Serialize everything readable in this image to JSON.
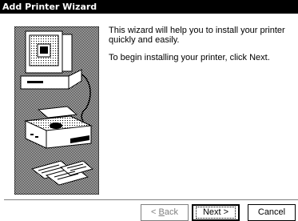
{
  "window": {
    "title": "Add Printer Wizard"
  },
  "content": {
    "paragraph1": "This wizard will help you to install your printer quickly and easily.",
    "paragraph2": "To begin installing your printer, click Next."
  },
  "buttons": {
    "back_prefix": "< ",
    "back_underlined": "B",
    "back_rest": "ack",
    "next_label": "Next >",
    "cancel_label": "Cancel"
  },
  "illustration": {
    "icon": "computer-and-printer-icon"
  }
}
